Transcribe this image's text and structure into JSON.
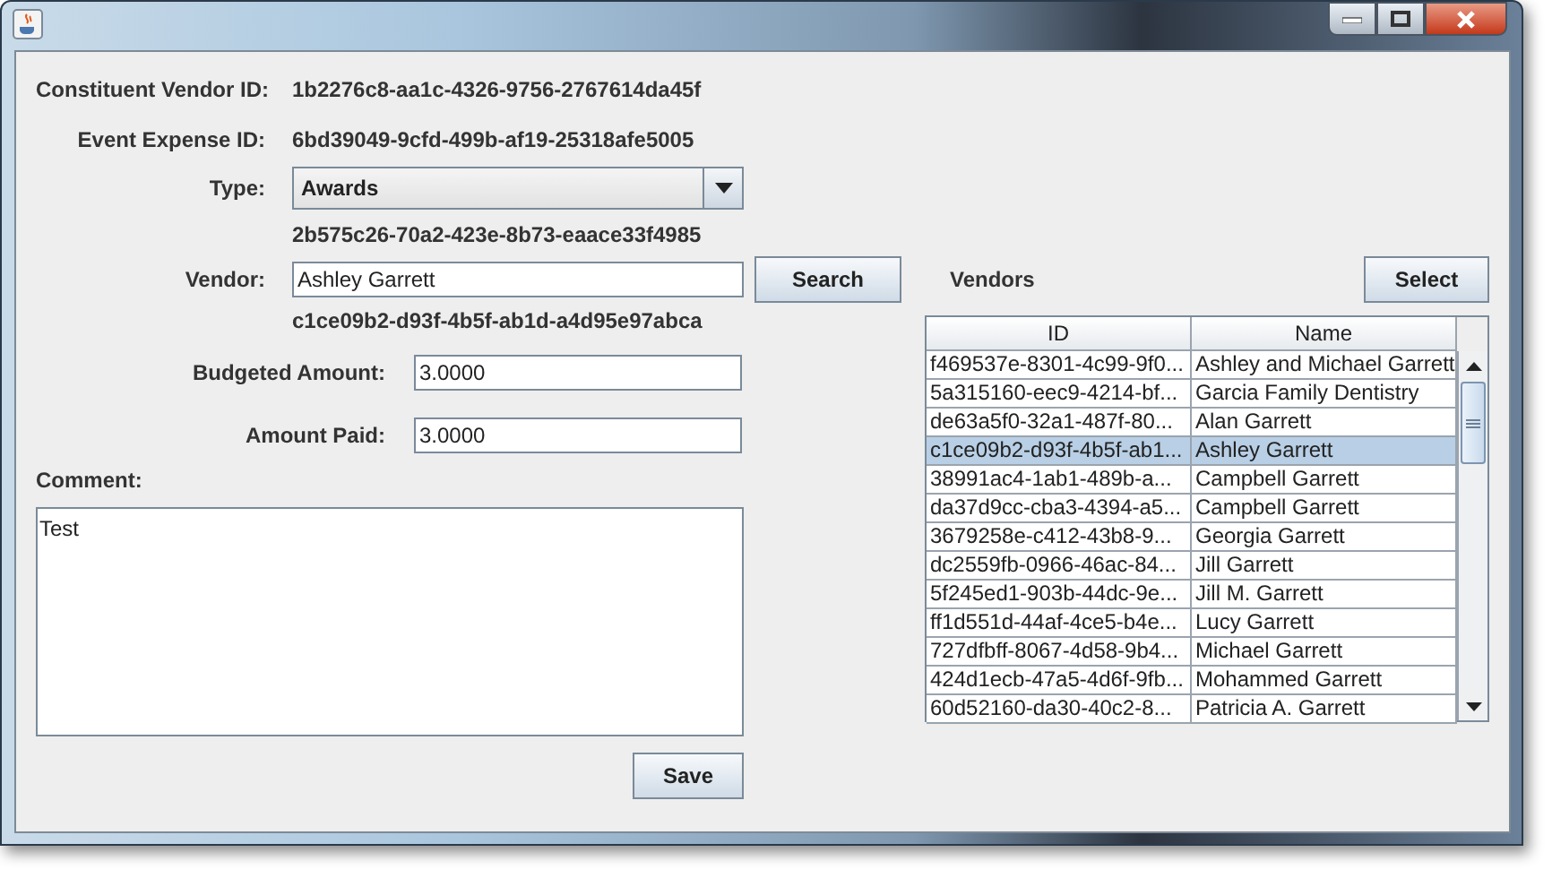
{
  "form": {
    "fields": [
      {
        "kind": "text",
        "label": "Constituent Vendor ID:",
        "value": "1b2276c8-aa1c-4326-9756-2767614da45f"
      },
      {
        "kind": "text",
        "label": "Event Expense ID:",
        "value": "6bd39049-9cfd-499b-af19-25318afe5005"
      },
      {
        "kind": "combo",
        "label": "Type:",
        "value": "Awards"
      },
      {
        "kind": "text",
        "value": "2b575c26-70a2-423e-8b73-eaace33f4985"
      },
      {
        "kind": "search",
        "label": "Vendor:",
        "value": "Ashley Garrett",
        "button": "Search"
      },
      {
        "kind": "text",
        "value": "c1ce09b2-d93f-4b5f-ab1d-a4d95e97abca"
      },
      {
        "kind": "amount",
        "label": "Budgeted Amount:",
        "value": "3.0000"
      },
      {
        "kind": "amount",
        "label": "Amount Paid:",
        "value": "3.0000"
      }
    ],
    "comment": {
      "label": "Comment:",
      "value": "Test"
    },
    "save_button": "Save"
  },
  "vendors": {
    "title": "Vendors",
    "select_button": "Select",
    "table": {
      "columns": [
        "ID",
        "Name"
      ],
      "rows": [
        {
          "cells": [
            "f469537e-8301-4c99-9f0...",
            "Ashley and Michael Garrett"
          ],
          "selected": false
        },
        {
          "cells": [
            "5a315160-eec9-4214-bf...",
            "Garcia Family Dentistry"
          ],
          "selected": false
        },
        {
          "cells": [
            "de63a5f0-32a1-487f-80...",
            "Alan Garrett"
          ],
          "selected": false
        },
        {
          "cells": [
            "c1ce09b2-d93f-4b5f-ab1...",
            "Ashley Garrett"
          ],
          "selected": true
        },
        {
          "cells": [
            "38991ac4-1ab1-489b-a...",
            "Campbell Garrett"
          ],
          "selected": false
        },
        {
          "cells": [
            "da37d9cc-cba3-4394-a5...",
            "Campbell Garrett"
          ],
          "selected": false
        },
        {
          "cells": [
            "3679258e-c412-43b8-9...",
            "Georgia Garrett"
          ],
          "selected": false
        },
        {
          "cells": [
            "dc2559fb-0966-46ac-84...",
            "Jill Garrett"
          ],
          "selected": false
        },
        {
          "cells": [
            "5f245ed1-903b-44dc-9e...",
            "Jill M. Garrett"
          ],
          "selected": false
        },
        {
          "cells": [
            "ff1d551d-44af-4ce5-b4e...",
            "Lucy Garrett"
          ],
          "selected": false
        },
        {
          "cells": [
            "727dfbff-8067-4d58-9b4...",
            "Michael Garrett"
          ],
          "selected": false
        },
        {
          "cells": [
            "424d1ecb-47a5-4d6f-9fb...",
            "Mohammed Garrett"
          ],
          "selected": false
        },
        {
          "cells": [
            "60d52160-da30-40c2-8...",
            "Patricia A. Garrett"
          ],
          "selected": false
        }
      ]
    }
  }
}
